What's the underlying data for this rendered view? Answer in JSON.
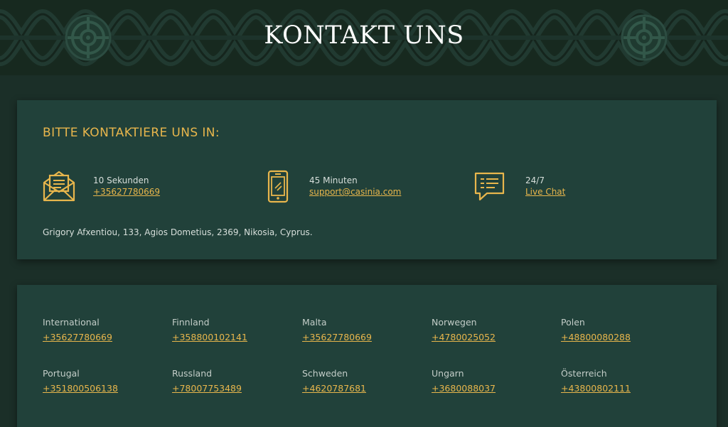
{
  "header": {
    "title": "KONTAKT UNS",
    "left_emblem_icon": "celtic-medallion-icon",
    "right_emblem_icon": "celtic-medallion-icon"
  },
  "contact": {
    "heading": "BITTE KONTAKTIERE UNS IN:",
    "channels": [
      {
        "icon": "envelope-icon",
        "time": "10 Sekunden",
        "link": "+35627780669"
      },
      {
        "icon": "smartphone-icon",
        "time": "45 Minuten",
        "link": "support@casinia.com"
      },
      {
        "icon": "chat-bubble-icon",
        "time": "24/7",
        "link": "Live Chat"
      }
    ],
    "address": "Grigory Afxentiou, 133, Agios Dometius, 2369, Nikosia, Cyprus."
  },
  "phones": [
    {
      "country": "International",
      "number": "+35627780669"
    },
    {
      "country": "Finnland",
      "number": "+358800102141"
    },
    {
      "country": "Malta",
      "number": "+35627780669"
    },
    {
      "country": "Norwegen",
      "number": "+4780025052"
    },
    {
      "country": "Polen",
      "number": "+48800080288"
    },
    {
      "country": "Portugal",
      "number": "+351800506138"
    },
    {
      "country": "Russland",
      "number": "+78007753489"
    },
    {
      "country": "Schweden",
      "number": "+4620787681"
    },
    {
      "country": "Ungarn",
      "number": "+3680088037"
    },
    {
      "country": "Österreich",
      "number": "+43800802111"
    }
  ],
  "colors": {
    "accent_gold": "#e8b64c",
    "card_bg": "#21413a",
    "page_bg": "#1b2f28",
    "header_bg": "#17291f"
  }
}
